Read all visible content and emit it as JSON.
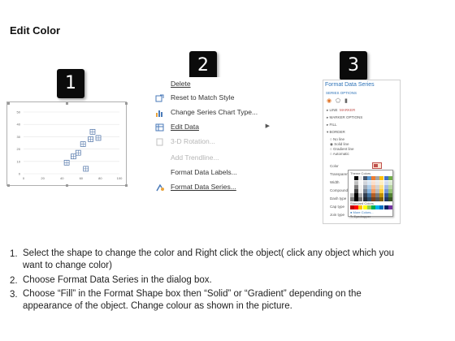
{
  "title": "Edit Color",
  "steps": {
    "one": "1",
    "two": "2",
    "three": "3"
  },
  "chart_data": {
    "type": "scatter",
    "x": [
      45,
      52,
      57,
      62,
      65,
      70,
      72,
      78
    ],
    "y": [
      9,
      14,
      17,
      24,
      4,
      28,
      34,
      29
    ],
    "x_ticks": [
      "0",
      "20",
      "40",
      "60",
      "80",
      "100"
    ],
    "y_ticks": [
      "0",
      "10",
      "20",
      "30",
      "40",
      "50"
    ],
    "xlim": [
      0,
      100
    ],
    "ylim": [
      0,
      50
    ]
  },
  "context_menu": {
    "items": [
      {
        "label": "Delete",
        "icon": "delete-icon",
        "enabled": true
      },
      {
        "label": "Reset to Match Style",
        "icon": "reset-icon",
        "enabled": true
      },
      {
        "label": "Change Series Chart Type...",
        "icon": "chart-type-icon",
        "enabled": true
      },
      {
        "label": "Edit Data",
        "icon": "edit-data-icon",
        "enabled": true,
        "submenu": true
      },
      {
        "label": "3-D Rotation...",
        "icon": "rotation-icon",
        "enabled": false
      },
      {
        "label": "Add Trendline...",
        "icon": "",
        "enabled": false
      },
      {
        "label": "Format Data Labels...",
        "icon": "",
        "enabled": true
      },
      {
        "label": "Format Data Series...",
        "icon": "format-series-icon",
        "enabled": true
      }
    ]
  },
  "format_pane": {
    "title": "Format Data Series",
    "series_options": "SERIES OPTIONS",
    "line": "LINE",
    "marker": "MARKER",
    "marker_options": "MARKER OPTIONS",
    "fill": "FILL",
    "border": "BORDER",
    "no_line": "No line",
    "solid_line": "Solid line",
    "gradient_line": "Gradient line",
    "automatic": "Automatic",
    "color": "Color",
    "transparency": "Transparency",
    "width": "Width",
    "compound": "Compound type",
    "dash": "Dash type",
    "cap": "Cap type",
    "join": "Join type",
    "theme_colors": "Theme Colors",
    "standard_colors": "Standard Colors",
    "more_colors": "More Colors...",
    "eyedropper": "Eyedropper",
    "accent": "#c0504d",
    "theme_row": [
      "#ffffff",
      "#000000",
      "#e7e6e6",
      "#44546a",
      "#5b9bd5",
      "#ed7d31",
      "#a5a5a5",
      "#ffc000",
      "#4472c4",
      "#70ad47"
    ],
    "standard_row": [
      "#c00000",
      "#ff0000",
      "#ffc000",
      "#ffff00",
      "#92d050",
      "#00b050",
      "#00b0f0",
      "#0070c0",
      "#002060",
      "#7030a0"
    ]
  },
  "instructions": [
    {
      "num": "1.",
      "line1": "Select the shape to change the color and Right click the object( click any object which you",
      "line2": "want to change color)"
    },
    {
      "num": "2.",
      "line1": "Choose Format Data Series in the dialog box.",
      "line2": ""
    },
    {
      "num": "3.",
      "line1": "Choose “Fill” in the Format Shape box then “Solid” or “Gradient” depending on the",
      "line2": "appearance of the object. Change colour as shown in the picture."
    }
  ]
}
